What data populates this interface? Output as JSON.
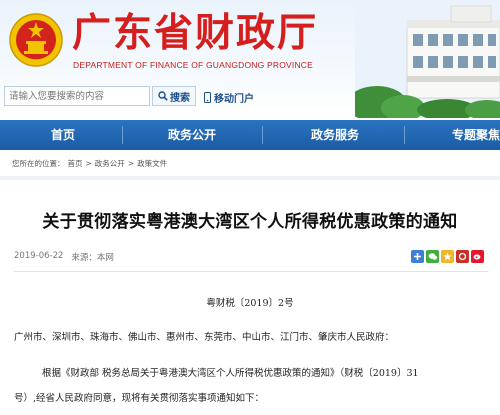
{
  "header": {
    "site_title": "广东省财政厅",
    "site_subtitle": "DEPARTMENT OF FINANCE OF GUANGDONG PROVINCE",
    "emblem_icon": "national-emblem-icon",
    "colors": {
      "title_red": "#d51e1e",
      "nav_blue": "#1b5ca5",
      "emblem_gold": "#f2c400"
    }
  },
  "search": {
    "placeholder": "请输入您要搜索的内容",
    "button_label": "搜索",
    "button_icon": "search-icon"
  },
  "mobile": {
    "label": "移动门户",
    "icon": "mobile-phone-icon"
  },
  "nav": {
    "items": [
      {
        "label": "首页"
      },
      {
        "label": "政务公开"
      },
      {
        "label": "政务服务"
      },
      {
        "label": "专题聚焦"
      }
    ]
  },
  "breadcrumb": {
    "prefix": "您所在的位置：",
    "items": [
      "首页",
      "政务公开",
      "政策文件"
    ],
    "separator": ">"
  },
  "article": {
    "title": "关于贯彻落实粤港澳大湾区个人所得税优惠政策的通知",
    "date": "2019-06-22",
    "source": "来源：本网",
    "doc_number": "粤财税〔2019〕2号",
    "addressee": "广州市、深圳市、珠海市、佛山市、惠州市、东莞市、中山市、江门市、肇庆市人民政府：",
    "body_line1": "根据《财政部 税务总局关于粤港澳大湾区个人所得税优惠政策的通知》（财税〔2019〕31",
    "body_line2": "号）,经省人民政府同意，现将有关贯彻落实事项通知如下："
  },
  "share": {
    "icons": [
      "share-plus-icon",
      "wechat-icon",
      "qzone-icon",
      "douban-icon",
      "weibo-icon"
    ]
  }
}
